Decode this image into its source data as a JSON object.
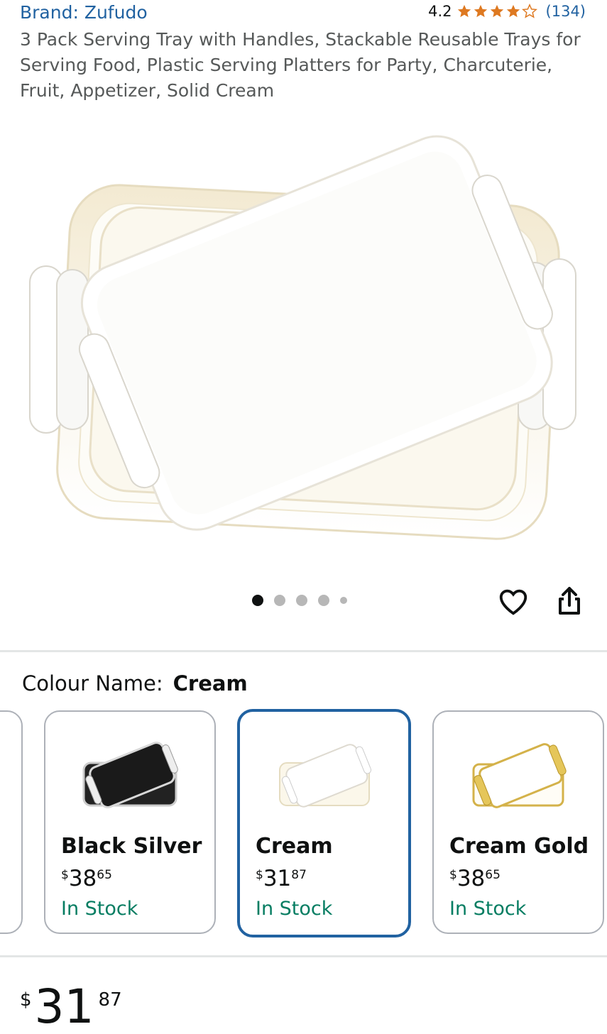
{
  "header": {
    "brand_link": "Brand: Zufudo",
    "rating_value": "4.2",
    "rating_stars": 4.2,
    "rating_count": "(134)",
    "title": "3 Pack Serving Tray with Handles, Stackable Reusable Trays for Serving Food, Plastic Serving Platters for Party, Charcuterie, Fruit, Appetizer, Solid Cream"
  },
  "gallery": {
    "image_count": 5,
    "active_index": 0,
    "actions": {
      "favorite_icon": "heart-icon",
      "share_icon": "share-icon"
    }
  },
  "variations": {
    "label": "Colour Name:",
    "selected_value": "Cream",
    "options": [
      {
        "name": "Black Silver",
        "price_symbol": "$",
        "price_whole": "38",
        "price_fraction": "65",
        "availability": "In Stock",
        "selected": false
      },
      {
        "name": "Cream",
        "price_symbol": "$",
        "price_whole": "31",
        "price_fraction": "87",
        "availability": "In Stock",
        "selected": true
      },
      {
        "name": "Cream Gold",
        "price_symbol": "$",
        "price_whole": "38",
        "price_fraction": "65",
        "availability": "In Stock",
        "selected": false
      }
    ]
  },
  "buybox": {
    "price_symbol": "$",
    "price_whole": "31",
    "price_fraction": "87"
  },
  "colors": {
    "link": "#2162a1",
    "star": "#de7921",
    "in_stock": "#067d62",
    "selected_border": "#2162a1"
  }
}
